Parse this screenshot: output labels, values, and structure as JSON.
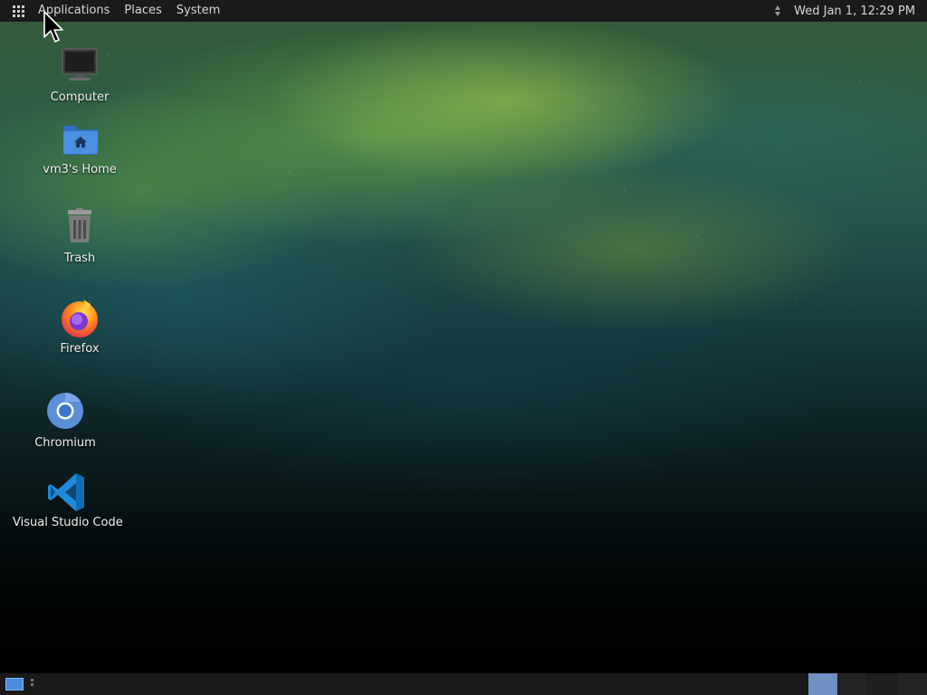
{
  "top_panel": {
    "menus": {
      "applications": "Applications",
      "places": "Places",
      "system": "System"
    },
    "clock": "Wed Jan  1, 12:29 PM"
  },
  "desktop_icons": {
    "computer": "Computer",
    "home": "vm3's Home",
    "trash": "Trash",
    "firefox": "Firefox",
    "chromium": "Chromium",
    "vscode": "Visual Studio Code"
  },
  "bottom_panel": {
    "active_workspace": 1,
    "workspace_count": 4
  },
  "colors": {
    "panel_bg": "#1a1a1a",
    "panel_text": "#d6d6d6",
    "active_workspace": "#6f8fc0",
    "show_desktop": "#4a8de0"
  }
}
